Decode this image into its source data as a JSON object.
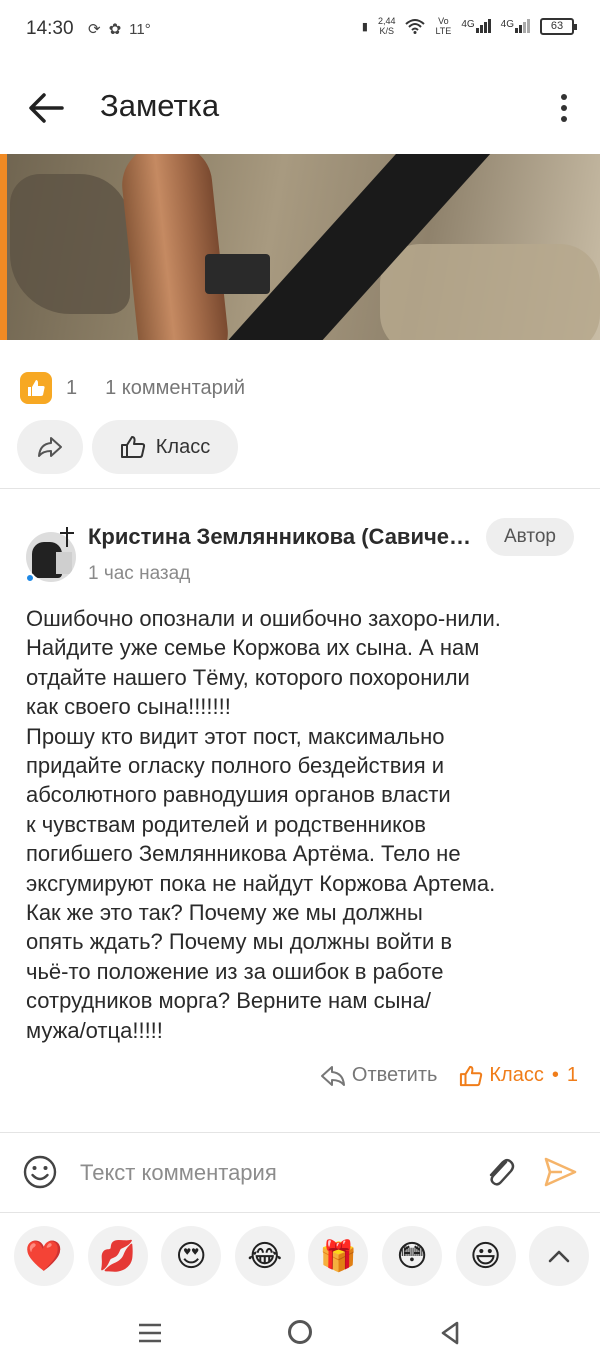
{
  "status_bar": {
    "time": "14:30",
    "temperature": "11°",
    "net_speed_value": "2,44",
    "net_speed_unit": "K/S",
    "volte_top": "Vo",
    "volte_bottom": "LTE",
    "sim1_label": "4G",
    "sim2_label": "4G",
    "battery": "63"
  },
  "app_bar": {
    "title": "Заметка"
  },
  "post": {
    "like_count": "1",
    "comments_count": "1 комментарий",
    "class_label": "Класс"
  },
  "comment": {
    "author": "Кристина Землянникова (Савичева)",
    "badge": "Автор",
    "time_ago": "1 час назад",
    "text": "Ошибочно опознали и ошибочно захоро-нили.\nНайдите уже семье Коржова их сына. А нам\nотдайте нашего Тёму, которого похоронили\nкак своего сына!!!!!!!\nПрошу кто видит этот пост, максимально\nпридайте огласку полного бездействия и\nабсолютного равнодушия органов власти\nк чувствам родителей и родственников\nпогибшего Землянникова Артёма. Тело не\nэксгумируют пока не найдут Коржова Артема.\nКак же это так? Почему же мы должны\nопять ждать? Почему мы должны войти в\nчьё-то положение из за ошибок в работе\nсотрудников морга? Верните нам сына/\nмужа/отца!!!!!",
    "reply_label": "Ответить",
    "class_label": "Класс",
    "separator": "•",
    "class_count": "1"
  },
  "input": {
    "placeholder": "Текст комментария"
  },
  "emojis": [
    {
      "name": "heart",
      "glyph": "❤️"
    },
    {
      "name": "kiss",
      "glyph": "💋"
    },
    {
      "name": "heart-eyes",
      "glyph": "😍"
    },
    {
      "name": "laughing",
      "glyph": "😂"
    },
    {
      "name": "gift",
      "glyph": "🎁"
    },
    {
      "name": "flushed",
      "glyph": "😳"
    },
    {
      "name": "smiley",
      "glyph": "😃"
    }
  ],
  "colors": {
    "accent": "#f07d1a",
    "like_badge": "#f7a823",
    "online": "#1e88e5"
  }
}
